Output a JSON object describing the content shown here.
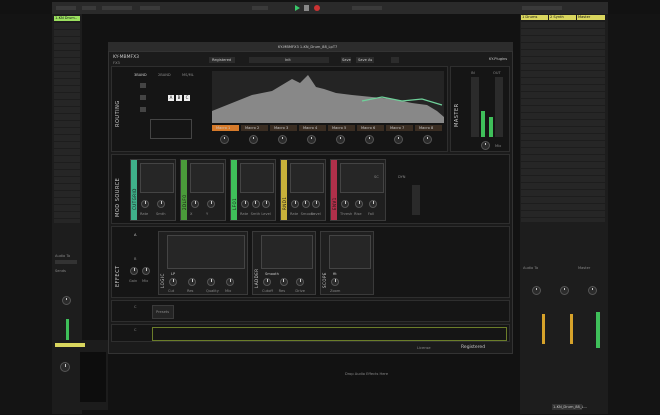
{
  "daw": {
    "track_left": "1-KN Drum..",
    "drop_files_top": "Drop Files and Devices Here",
    "drop_audio_effects": "Drop Audio Effects Here",
    "track_right_1": "1 Drums",
    "track_right_2": "2 Synth",
    "track_right_3": "Master",
    "track_name_bottom": "1-KN_Drum_88_L...",
    "audio_to": "Audio To",
    "master_out": "Master",
    "sends": "Sends",
    "colors": {
      "accent_green": "#9be05f",
      "accent_yellow": "#d9d65e",
      "play": "#39c86a"
    }
  },
  "plugin": {
    "window_title": "KY-MBMFX3 1-KN_Drum_88_LpT7",
    "brand": "KY-MBMFX3",
    "brand_sub": "FX3",
    "company": "KY-Plugins",
    "registered_label": "Registered",
    "preset_name": "Init",
    "save_label": "Save",
    "save_as_label": "Save As",
    "footer_license": "License",
    "footer_registered": "Registered",
    "routing": {
      "label": "ROUTING",
      "tabs": [
        "3BAND",
        "2BAND",
        "MS/ML"
      ],
      "chain": [
        "A",
        "B",
        "C"
      ],
      "macros": [
        "Macro 1",
        "Macro 2",
        "Macro 3",
        "Macro 4",
        "Macro 5",
        "Macro 6",
        "Macro 7",
        "Macro 8"
      ]
    },
    "master": {
      "label": "MASTER",
      "in": "IN",
      "out": "OUT",
      "mix": "Mix"
    },
    "mod_source": {
      "label": "MOD SOURCE",
      "modules": [
        {
          "name": "CUTGRID",
          "knobs": [
            "Rate",
            "Smth"
          ],
          "color": "#3fb08a"
        },
        {
          "name": "2DLFO",
          "knobs": [
            "X",
            "Y"
          ],
          "color": "#4a9a3a"
        },
        {
          "name": "LFO1",
          "knobs": [
            "Rate",
            "Smth",
            "Level"
          ],
          "color": "#3fbf5a"
        },
        {
          "name": "RND1",
          "knobs": [
            "Rate",
            "Smooth",
            "Level"
          ],
          "color": "#c9b13a"
        },
        {
          "name": "ENV1",
          "knobs": [
            "Thresh",
            "Rise",
            "Fall"
          ],
          "color": "#b0304a"
        }
      ],
      "extra": [
        "SC",
        "DYN",
        "Gain",
        "Fmp",
        "In Gain"
      ]
    },
    "effect": {
      "label": "EFFECT",
      "rows": [
        "A",
        "B",
        "C",
        "C"
      ],
      "row_knobs": [
        "Gain",
        "Mix"
      ],
      "modules": [
        {
          "name": "LOGIC",
          "knobs": [
            "Cut",
            "Res",
            "Quality",
            "Mix"
          ],
          "mode": "LP"
        },
        {
          "name": "LADDER",
          "knobs": [
            "Cutoff",
            "Res",
            "Drive"
          ],
          "mode": "Smooth"
        },
        {
          "name": "SCOPE",
          "knobs": [
            "Zoom"
          ],
          "mode": "fit"
        }
      ],
      "bypass_label": "Presets"
    }
  }
}
